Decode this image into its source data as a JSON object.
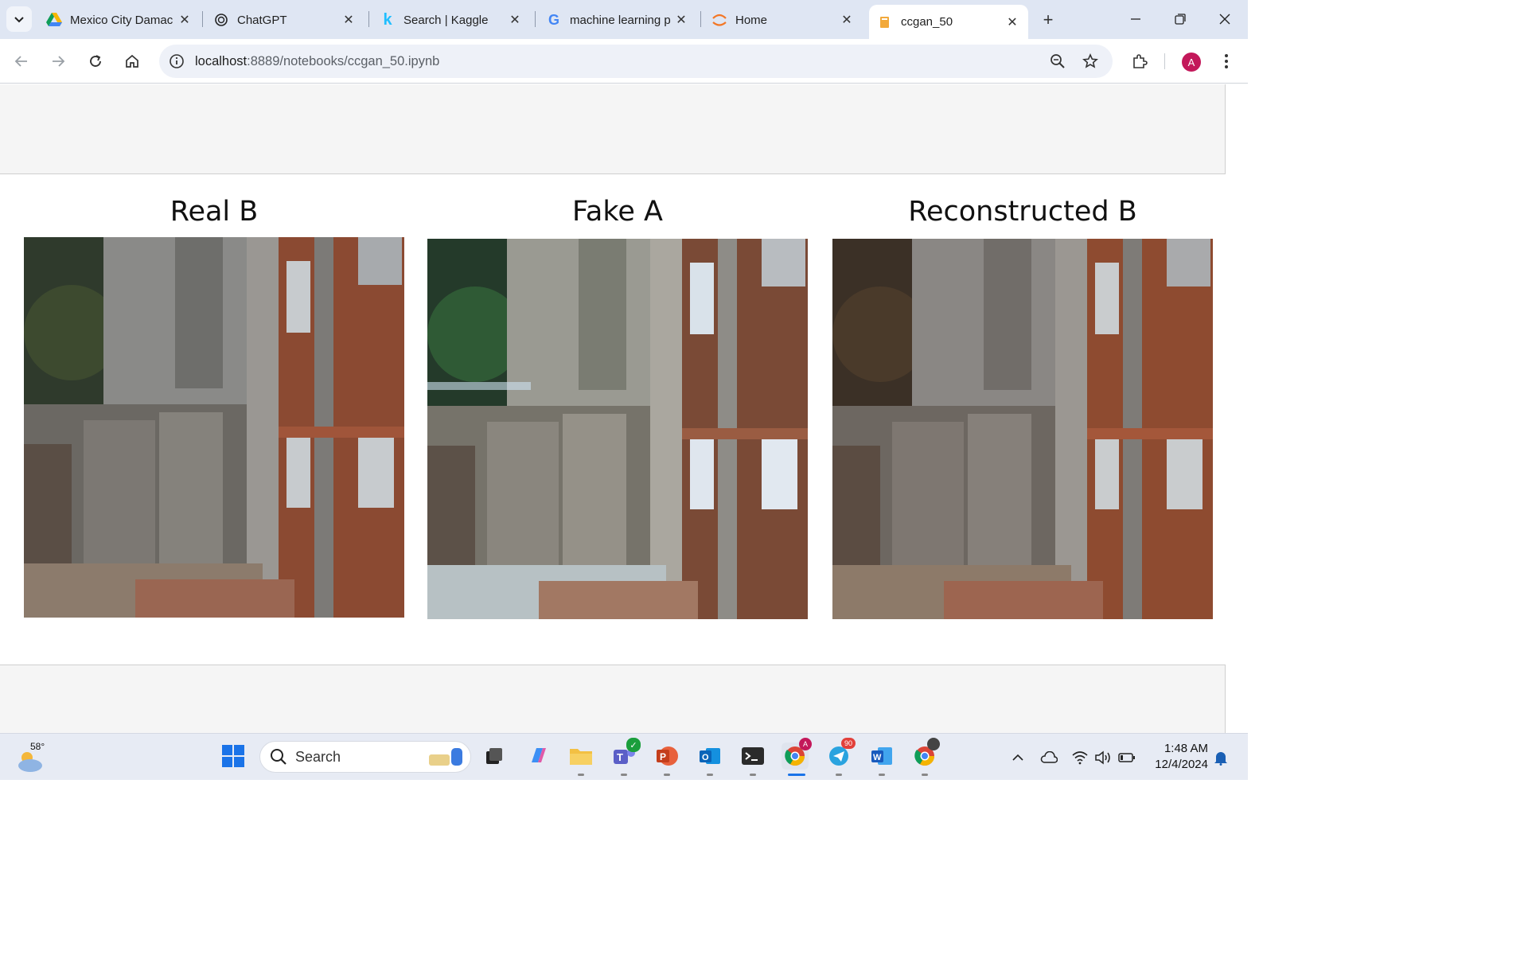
{
  "browser": {
    "tabs": [
      {
        "title": "Mexico City Damac",
        "icon": "google-drive-icon"
      },
      {
        "title": "ChatGPT",
        "icon": "chatgpt-icon"
      },
      {
        "title": "Search | Kaggle",
        "icon": "kaggle-icon"
      },
      {
        "title": "machine learning p",
        "icon": "google-icon"
      },
      {
        "title": "Home",
        "icon": "jupyter-icon"
      },
      {
        "title": "ccgan_50",
        "icon": "notebook-icon",
        "active": true
      }
    ],
    "url_host": "localhost",
    "url_path": ":8889/notebooks/ccgan_50.ipynb",
    "profile_initial": "A"
  },
  "notebook": {
    "panels": [
      {
        "title": "Real B"
      },
      {
        "title": "Fake A"
      },
      {
        "title": "Reconstructed B"
      }
    ]
  },
  "taskbar": {
    "weather_temp": "58°",
    "search_placeholder": "Search",
    "telegram_badge": "90",
    "chrome_badge": "A",
    "time": "1:48 AM",
    "date": "12/4/2024"
  },
  "colors": {
    "tabstrip_bg": "#dfe6f3",
    "profile_accent": "#c3185a",
    "cell_bg": "#f5f5f5"
  }
}
